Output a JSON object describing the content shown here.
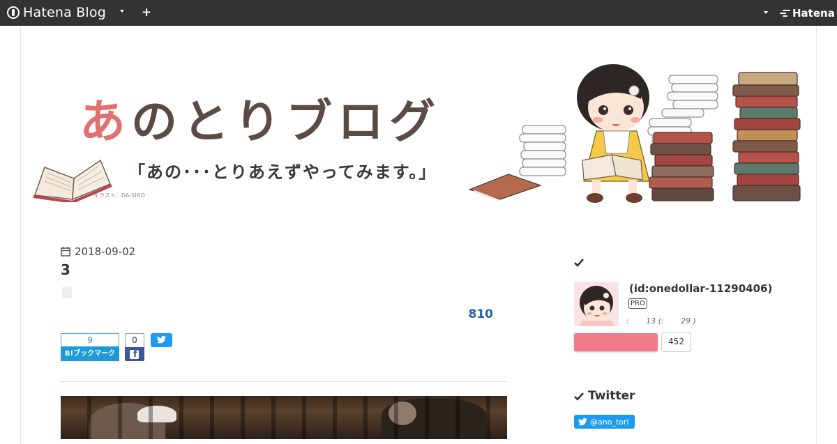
{
  "topbar": {
    "logo_text": "Hatena Blog",
    "add_symbol": "+",
    "service_name": "Hatena",
    "background_color": "#333333"
  },
  "banner": {
    "title_first": "あ",
    "title_rest": "のとりブログ",
    "subtitle": "「あの･･･とりあえずやってみます。」",
    "credit": "イラスト：DA-SHIO",
    "title_color": "#5c4b45",
    "accent_color": "#e0716e"
  },
  "entry": {
    "date": "2018-09-02",
    "title": "3",
    "count": "810",
    "share": {
      "hatena_count": "9",
      "hatena_label": "B!ブックマーク",
      "facebook_count": "0"
    }
  },
  "sidebar": {
    "profile": {
      "id_text": "(id:onedollar-11290406)",
      "badge": "PRO",
      "stats": ":       13 (:       29 )",
      "readers_count": "452",
      "read_button_color": "#f2788b"
    },
    "twitter": {
      "title": "Twitter",
      "follow_handle": "@ano_tori"
    }
  },
  "colors": {
    "link_blue": "#2360a5",
    "twitter_blue": "#1d9bf0",
    "hatena_blue": "#1d9ad8",
    "facebook_blue": "#3b5998"
  }
}
